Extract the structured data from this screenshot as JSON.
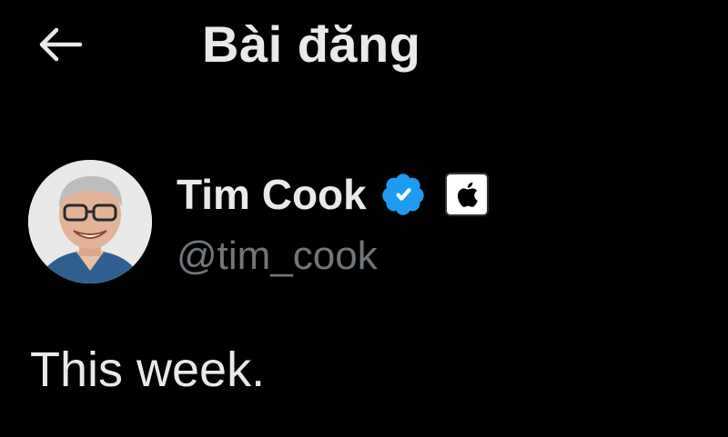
{
  "header": {
    "back_icon": "arrow-left-icon",
    "title": "Bài đăng"
  },
  "author": {
    "avatar_icon": "avatar-photo",
    "name": "Tim Cook",
    "verified_icon": "verified-badge-icon",
    "org_icon": "apple-logo-icon",
    "handle": "@tim_cook"
  },
  "post": {
    "text": "This week."
  },
  "colors": {
    "background": "#000000",
    "primary_text": "#e7e9ea",
    "secondary_text": "#71767b",
    "verified_blue": "#1d9bf0"
  }
}
